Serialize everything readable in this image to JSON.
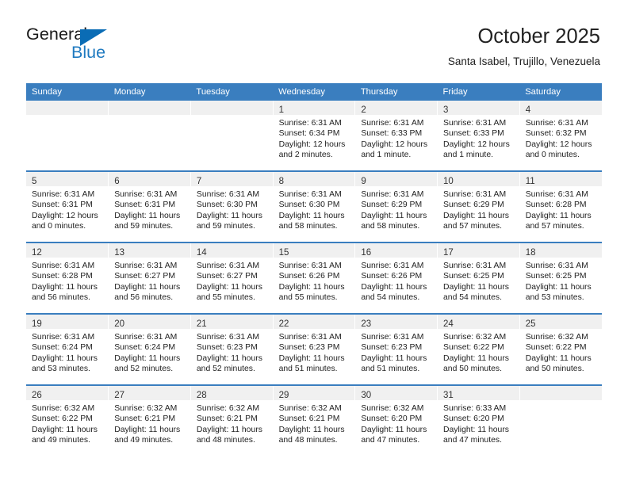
{
  "brand": {
    "name_part1": "General",
    "name_part2": "Blue",
    "accent_color": "#0a6cb5",
    "logo_icon": "triangle-flag-icon"
  },
  "header": {
    "title": "October 2025",
    "subtitle": "Santa Isabel, Trujillo, Venezuela"
  },
  "calendar": {
    "header_color": "#3a7ebf",
    "weekdays": [
      "Sunday",
      "Monday",
      "Tuesday",
      "Wednesday",
      "Thursday",
      "Friday",
      "Saturday"
    ],
    "weeks": [
      [
        {
          "day": "",
          "sunrise": "",
          "sunset": "",
          "daylight1": "",
          "daylight2": ""
        },
        {
          "day": "",
          "sunrise": "",
          "sunset": "",
          "daylight1": "",
          "daylight2": ""
        },
        {
          "day": "",
          "sunrise": "",
          "sunset": "",
          "daylight1": "",
          "daylight2": ""
        },
        {
          "day": "1",
          "sunrise": "Sunrise: 6:31 AM",
          "sunset": "Sunset: 6:34 PM",
          "daylight1": "Daylight: 12 hours",
          "daylight2": "and 2 minutes."
        },
        {
          "day": "2",
          "sunrise": "Sunrise: 6:31 AM",
          "sunset": "Sunset: 6:33 PM",
          "daylight1": "Daylight: 12 hours",
          "daylight2": "and 1 minute."
        },
        {
          "day": "3",
          "sunrise": "Sunrise: 6:31 AM",
          "sunset": "Sunset: 6:33 PM",
          "daylight1": "Daylight: 12 hours",
          "daylight2": "and 1 minute."
        },
        {
          "day": "4",
          "sunrise": "Sunrise: 6:31 AM",
          "sunset": "Sunset: 6:32 PM",
          "daylight1": "Daylight: 12 hours",
          "daylight2": "and 0 minutes."
        }
      ],
      [
        {
          "day": "5",
          "sunrise": "Sunrise: 6:31 AM",
          "sunset": "Sunset: 6:31 PM",
          "daylight1": "Daylight: 12 hours",
          "daylight2": "and 0 minutes."
        },
        {
          "day": "6",
          "sunrise": "Sunrise: 6:31 AM",
          "sunset": "Sunset: 6:31 PM",
          "daylight1": "Daylight: 11 hours",
          "daylight2": "and 59 minutes."
        },
        {
          "day": "7",
          "sunrise": "Sunrise: 6:31 AM",
          "sunset": "Sunset: 6:30 PM",
          "daylight1": "Daylight: 11 hours",
          "daylight2": "and 59 minutes."
        },
        {
          "day": "8",
          "sunrise": "Sunrise: 6:31 AM",
          "sunset": "Sunset: 6:30 PM",
          "daylight1": "Daylight: 11 hours",
          "daylight2": "and 58 minutes."
        },
        {
          "day": "9",
          "sunrise": "Sunrise: 6:31 AM",
          "sunset": "Sunset: 6:29 PM",
          "daylight1": "Daylight: 11 hours",
          "daylight2": "and 58 minutes."
        },
        {
          "day": "10",
          "sunrise": "Sunrise: 6:31 AM",
          "sunset": "Sunset: 6:29 PM",
          "daylight1": "Daylight: 11 hours",
          "daylight2": "and 57 minutes."
        },
        {
          "day": "11",
          "sunrise": "Sunrise: 6:31 AM",
          "sunset": "Sunset: 6:28 PM",
          "daylight1": "Daylight: 11 hours",
          "daylight2": "and 57 minutes."
        }
      ],
      [
        {
          "day": "12",
          "sunrise": "Sunrise: 6:31 AM",
          "sunset": "Sunset: 6:28 PM",
          "daylight1": "Daylight: 11 hours",
          "daylight2": "and 56 minutes."
        },
        {
          "day": "13",
          "sunrise": "Sunrise: 6:31 AM",
          "sunset": "Sunset: 6:27 PM",
          "daylight1": "Daylight: 11 hours",
          "daylight2": "and 56 minutes."
        },
        {
          "day": "14",
          "sunrise": "Sunrise: 6:31 AM",
          "sunset": "Sunset: 6:27 PM",
          "daylight1": "Daylight: 11 hours",
          "daylight2": "and 55 minutes."
        },
        {
          "day": "15",
          "sunrise": "Sunrise: 6:31 AM",
          "sunset": "Sunset: 6:26 PM",
          "daylight1": "Daylight: 11 hours",
          "daylight2": "and 55 minutes."
        },
        {
          "day": "16",
          "sunrise": "Sunrise: 6:31 AM",
          "sunset": "Sunset: 6:26 PM",
          "daylight1": "Daylight: 11 hours",
          "daylight2": "and 54 minutes."
        },
        {
          "day": "17",
          "sunrise": "Sunrise: 6:31 AM",
          "sunset": "Sunset: 6:25 PM",
          "daylight1": "Daylight: 11 hours",
          "daylight2": "and 54 minutes."
        },
        {
          "day": "18",
          "sunrise": "Sunrise: 6:31 AM",
          "sunset": "Sunset: 6:25 PM",
          "daylight1": "Daylight: 11 hours",
          "daylight2": "and 53 minutes."
        }
      ],
      [
        {
          "day": "19",
          "sunrise": "Sunrise: 6:31 AM",
          "sunset": "Sunset: 6:24 PM",
          "daylight1": "Daylight: 11 hours",
          "daylight2": "and 53 minutes."
        },
        {
          "day": "20",
          "sunrise": "Sunrise: 6:31 AM",
          "sunset": "Sunset: 6:24 PM",
          "daylight1": "Daylight: 11 hours",
          "daylight2": "and 52 minutes."
        },
        {
          "day": "21",
          "sunrise": "Sunrise: 6:31 AM",
          "sunset": "Sunset: 6:23 PM",
          "daylight1": "Daylight: 11 hours",
          "daylight2": "and 52 minutes."
        },
        {
          "day": "22",
          "sunrise": "Sunrise: 6:31 AM",
          "sunset": "Sunset: 6:23 PM",
          "daylight1": "Daylight: 11 hours",
          "daylight2": "and 51 minutes."
        },
        {
          "day": "23",
          "sunrise": "Sunrise: 6:31 AM",
          "sunset": "Sunset: 6:23 PM",
          "daylight1": "Daylight: 11 hours",
          "daylight2": "and 51 minutes."
        },
        {
          "day": "24",
          "sunrise": "Sunrise: 6:32 AM",
          "sunset": "Sunset: 6:22 PM",
          "daylight1": "Daylight: 11 hours",
          "daylight2": "and 50 minutes."
        },
        {
          "day": "25",
          "sunrise": "Sunrise: 6:32 AM",
          "sunset": "Sunset: 6:22 PM",
          "daylight1": "Daylight: 11 hours",
          "daylight2": "and 50 minutes."
        }
      ],
      [
        {
          "day": "26",
          "sunrise": "Sunrise: 6:32 AM",
          "sunset": "Sunset: 6:22 PM",
          "daylight1": "Daylight: 11 hours",
          "daylight2": "and 49 minutes."
        },
        {
          "day": "27",
          "sunrise": "Sunrise: 6:32 AM",
          "sunset": "Sunset: 6:21 PM",
          "daylight1": "Daylight: 11 hours",
          "daylight2": "and 49 minutes."
        },
        {
          "day": "28",
          "sunrise": "Sunrise: 6:32 AM",
          "sunset": "Sunset: 6:21 PM",
          "daylight1": "Daylight: 11 hours",
          "daylight2": "and 48 minutes."
        },
        {
          "day": "29",
          "sunrise": "Sunrise: 6:32 AM",
          "sunset": "Sunset: 6:21 PM",
          "daylight1": "Daylight: 11 hours",
          "daylight2": "and 48 minutes."
        },
        {
          "day": "30",
          "sunrise": "Sunrise: 6:32 AM",
          "sunset": "Sunset: 6:20 PM",
          "daylight1": "Daylight: 11 hours",
          "daylight2": "and 47 minutes."
        },
        {
          "day": "31",
          "sunrise": "Sunrise: 6:33 AM",
          "sunset": "Sunset: 6:20 PM",
          "daylight1": "Daylight: 11 hours",
          "daylight2": "and 47 minutes."
        },
        {
          "day": "",
          "sunrise": "",
          "sunset": "",
          "daylight1": "",
          "daylight2": ""
        }
      ]
    ]
  }
}
